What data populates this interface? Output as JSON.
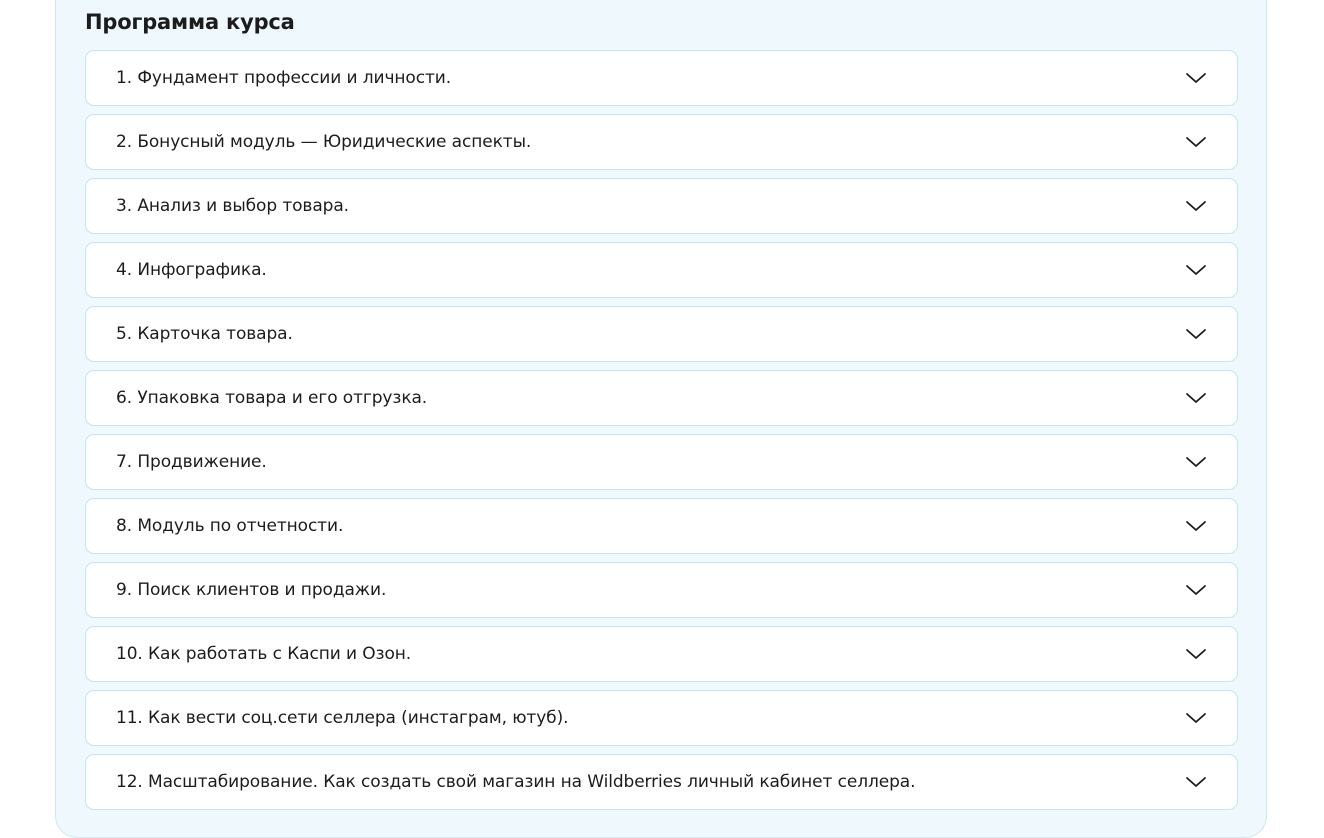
{
  "section": {
    "title": "Программа курса"
  },
  "modules": [
    {
      "label": "1. Фундамент профессии и личности.",
      "icon": "chevron-down-icon"
    },
    {
      "label": "2. Бонусный модуль — Юридические аспекты.",
      "icon": "chevron-down-icon"
    },
    {
      "label": "3. Анализ и выбор товара.",
      "icon": "chevron-down-icon"
    },
    {
      "label": "4. Инфографика.",
      "icon": "chevron-down-icon"
    },
    {
      "label": "5. Карточка товара.",
      "icon": "chevron-down-icon"
    },
    {
      "label": "6. Упаковка товара и его отгрузка.",
      "icon": "chevron-down-icon"
    },
    {
      "label": "7. Продвижение.",
      "icon": "chevron-down-icon"
    },
    {
      "label": "8. Модуль по отчетности.",
      "icon": "chevron-down-icon"
    },
    {
      "label": "9. Поиск клиентов и продажи.",
      "icon": "chevron-down-icon"
    },
    {
      "label": "10. Как работать с Каспи и Озон.",
      "icon": "chevron-down-icon"
    },
    {
      "label": "11. Как вести соц.сети селлера (инстаграм, ютуб).",
      "icon": "chevron-down-icon"
    },
    {
      "label": "12. Масштабирование. Как создать свой магазин на Wildberries личный кабинет селлера.",
      "icon": "chevron-down-icon"
    }
  ],
  "colors": {
    "panel_background": "#eef8fd",
    "item_border": "#c3e6f1",
    "text": "#1c1c1c"
  }
}
